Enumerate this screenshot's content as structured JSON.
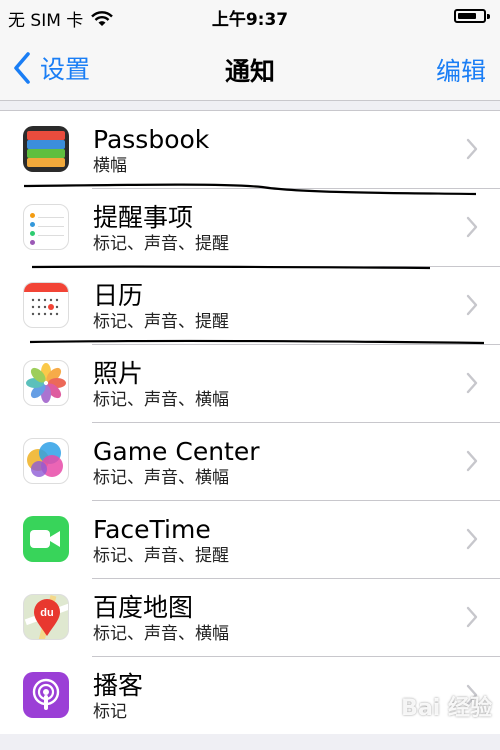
{
  "status_bar": {
    "carrier": "无 SIM 卡",
    "time": "上午9:37",
    "battery_level": 0.75
  },
  "nav": {
    "back_label": "设置",
    "title": "通知",
    "edit_label": "编辑"
  },
  "apps": [
    {
      "name": "Passbook",
      "detail": "横幅",
      "icon": "passbook-icon"
    },
    {
      "name": "提醒事项",
      "detail": "标记、声音、提醒",
      "icon": "reminders-icon"
    },
    {
      "name": "日历",
      "detail": "标记、声音、提醒",
      "icon": "calendar-icon"
    },
    {
      "name": "照片",
      "detail": "标记、声音、横幅",
      "icon": "photos-icon"
    },
    {
      "name": "Game Center",
      "detail": "标记、声音、横幅",
      "icon": "game-center-icon"
    },
    {
      "name": "FaceTime",
      "detail": "标记、声音、提醒",
      "icon": "facetime-icon"
    },
    {
      "name": "百度地图",
      "detail": "标记、声音、横幅",
      "icon": "baidu-map-icon"
    },
    {
      "name": "播客",
      "detail": "标记",
      "icon": "podcasts-icon"
    }
  ],
  "watermark": "Bai 经验",
  "colors": {
    "accent": "#1a7ef5",
    "separator": "#c8c7cc",
    "background": "#efeff4"
  }
}
